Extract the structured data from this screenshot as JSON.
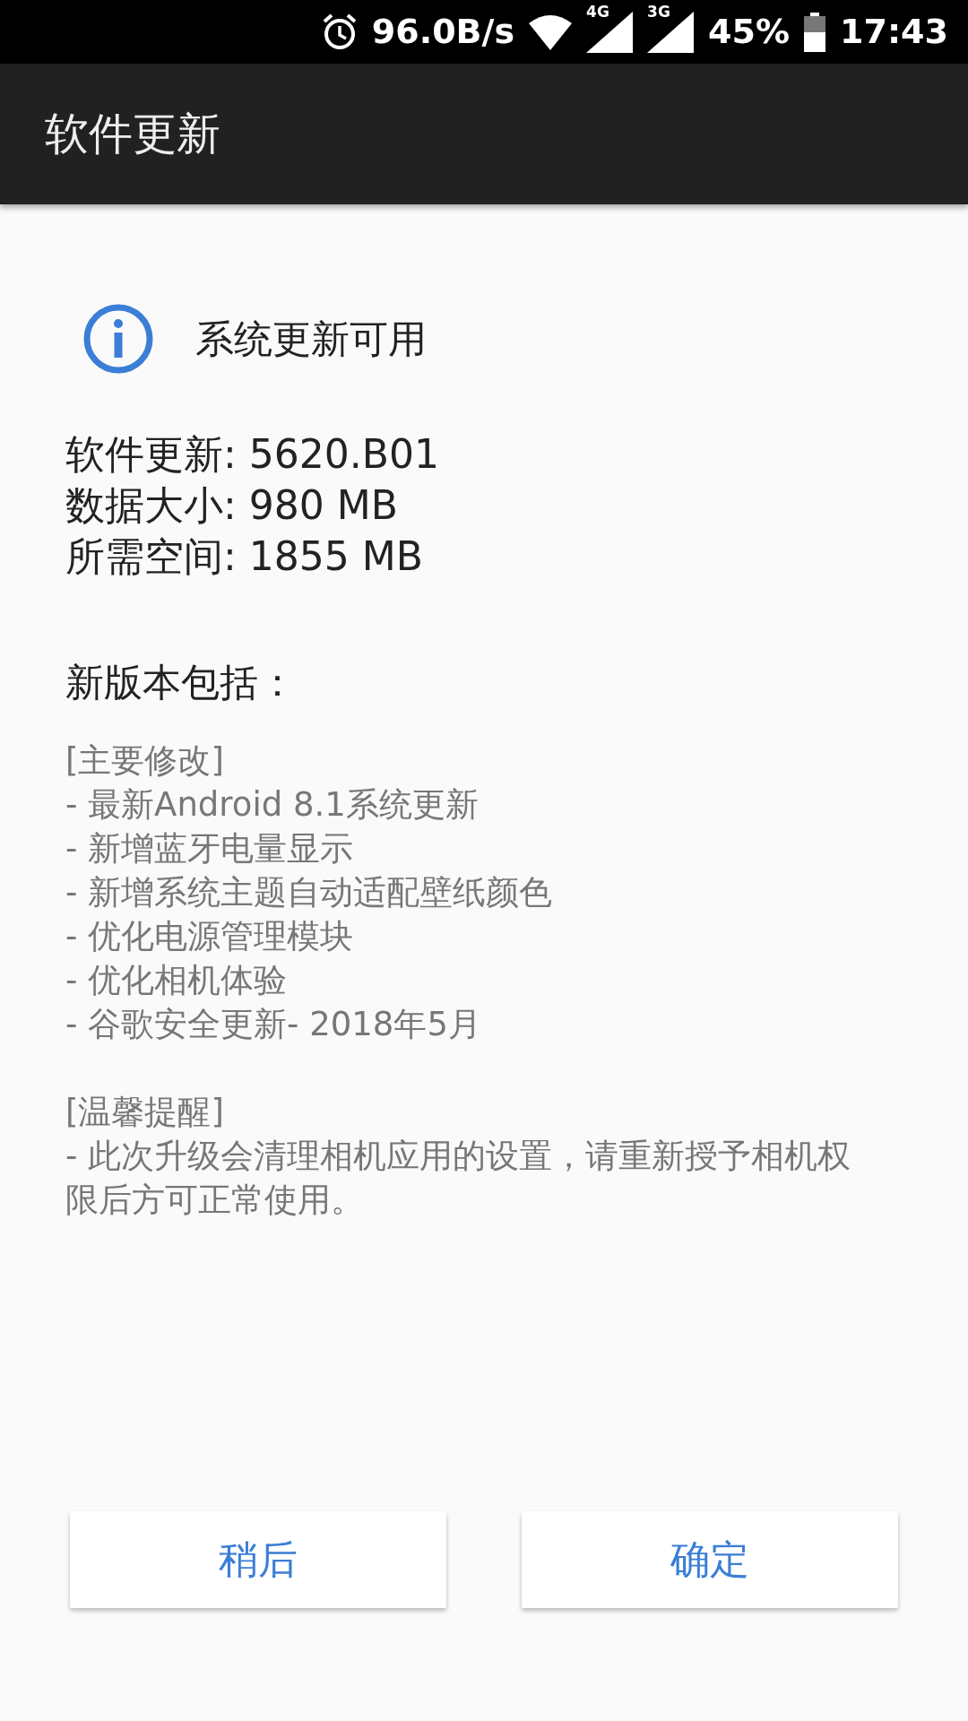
{
  "status_bar": {
    "net_speed": "96.0B/s",
    "signals": [
      "4G",
      "3G"
    ],
    "battery": "45%",
    "time": "17:43"
  },
  "app_bar": {
    "title": "软件更新"
  },
  "notice": {
    "text": "系统更新可用"
  },
  "details": [
    "软件更新: 5620.B01",
    "数据大小: 980 MB",
    "所需空间: 1855 MB"
  ],
  "changes_heading": "新版本包括：",
  "sections": [
    {
      "title": "[主要修改]",
      "items": [
        "- 最新Android 8.1系统更新",
        "- 新增蓝牙电量显示",
        "- 新增系统主题自动适配壁纸颜色",
        "- 优化电源管理模块",
        "- 优化相机体验",
        "- 谷歌安全更新- 2018年5月"
      ]
    },
    {
      "title": "[温馨提醒]",
      "items": [
        "- 此次升级会清理相机应用的设置，请重新授予相机权限后方可正常使用。"
      ]
    }
  ],
  "buttons": [
    "稍后",
    "确定"
  ]
}
